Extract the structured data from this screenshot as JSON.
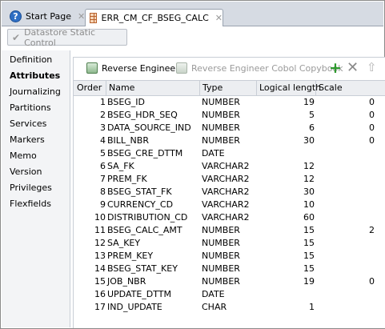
{
  "tabs": {
    "start": {
      "label": "Start Page"
    },
    "active": {
      "label": "ERR_CM_CF_BSEG_CALC"
    }
  },
  "toolbar": {
    "datastore_static_control": "Datastore Static Control"
  },
  "nav": {
    "items": [
      {
        "label": "Definition"
      },
      {
        "label": "Attributes"
      },
      {
        "label": "Journalizing"
      },
      {
        "label": "Partitions"
      },
      {
        "label": "Services"
      },
      {
        "label": "Markers"
      },
      {
        "label": "Memo"
      },
      {
        "label": "Version"
      },
      {
        "label": "Privileges"
      },
      {
        "label": "Flexfields"
      }
    ],
    "selected": "Attributes"
  },
  "attributes_toolbar": {
    "reverse_engineer": "Reverse Engineer",
    "reverse_engineer_cobol": "Reverse Engineer Cobol Copybook"
  },
  "table": {
    "headers": {
      "order": "Order",
      "name": "Name",
      "type": "Type",
      "length": "Logical length",
      "scale": "Scale"
    },
    "rows": [
      {
        "order": "1",
        "name": "BSEG_ID",
        "type": "NUMBER",
        "length": "19",
        "scale": "0"
      },
      {
        "order": "2",
        "name": "BSEG_HDR_SEQ",
        "type": "NUMBER",
        "length": "5",
        "scale": "0"
      },
      {
        "order": "3",
        "name": "DATA_SOURCE_IND",
        "type": "NUMBER",
        "length": "6",
        "scale": "0"
      },
      {
        "order": "4",
        "name": "BILL_NBR",
        "type": "NUMBER",
        "length": "30",
        "scale": "0"
      },
      {
        "order": "5",
        "name": "BSEG_CRE_DTTM",
        "type": "DATE",
        "length": "",
        "scale": ""
      },
      {
        "order": "6",
        "name": "SA_FK",
        "type": "VARCHAR2",
        "length": "12",
        "scale": ""
      },
      {
        "order": "7",
        "name": "PREM_FK",
        "type": "VARCHAR2",
        "length": "12",
        "scale": ""
      },
      {
        "order": "8",
        "name": "BSEG_STAT_FK",
        "type": "VARCHAR2",
        "length": "30",
        "scale": ""
      },
      {
        "order": "9",
        "name": "CURRENCY_CD",
        "type": "VARCHAR2",
        "length": "10",
        "scale": ""
      },
      {
        "order": "10",
        "name": "DISTRIBUTION_CD",
        "type": "VARCHAR2",
        "length": "60",
        "scale": ""
      },
      {
        "order": "11",
        "name": "BSEG_CALC_AMT",
        "type": "NUMBER",
        "length": "15",
        "scale": "2"
      },
      {
        "order": "12",
        "name": "SA_KEY",
        "type": "NUMBER",
        "length": "15",
        "scale": ""
      },
      {
        "order": "13",
        "name": "PREM_KEY",
        "type": "NUMBER",
        "length": "15",
        "scale": ""
      },
      {
        "order": "14",
        "name": "BSEG_STAT_KEY",
        "type": "NUMBER",
        "length": "15",
        "scale": ""
      },
      {
        "order": "15",
        "name": "JOB_NBR",
        "type": "NUMBER",
        "length": "19",
        "scale": "0"
      },
      {
        "order": "16",
        "name": "UPDATE_DTTM",
        "type": "DATE",
        "length": "",
        "scale": ""
      },
      {
        "order": "17",
        "name": "IND_UPDATE",
        "type": "CHAR",
        "length": "1",
        "scale": ""
      }
    ]
  },
  "colors": {
    "tab_strip": "#d6dbe3",
    "header_bg": "#eceef1",
    "help_icon": "#2f6fc4",
    "add_icon": "#2e9a2e"
  },
  "icons": [
    "help-icon",
    "table-grid-icon",
    "checkmark-icon",
    "reverse-engineer-icon",
    "add-icon",
    "delete-icon",
    "move-up-icon"
  ]
}
